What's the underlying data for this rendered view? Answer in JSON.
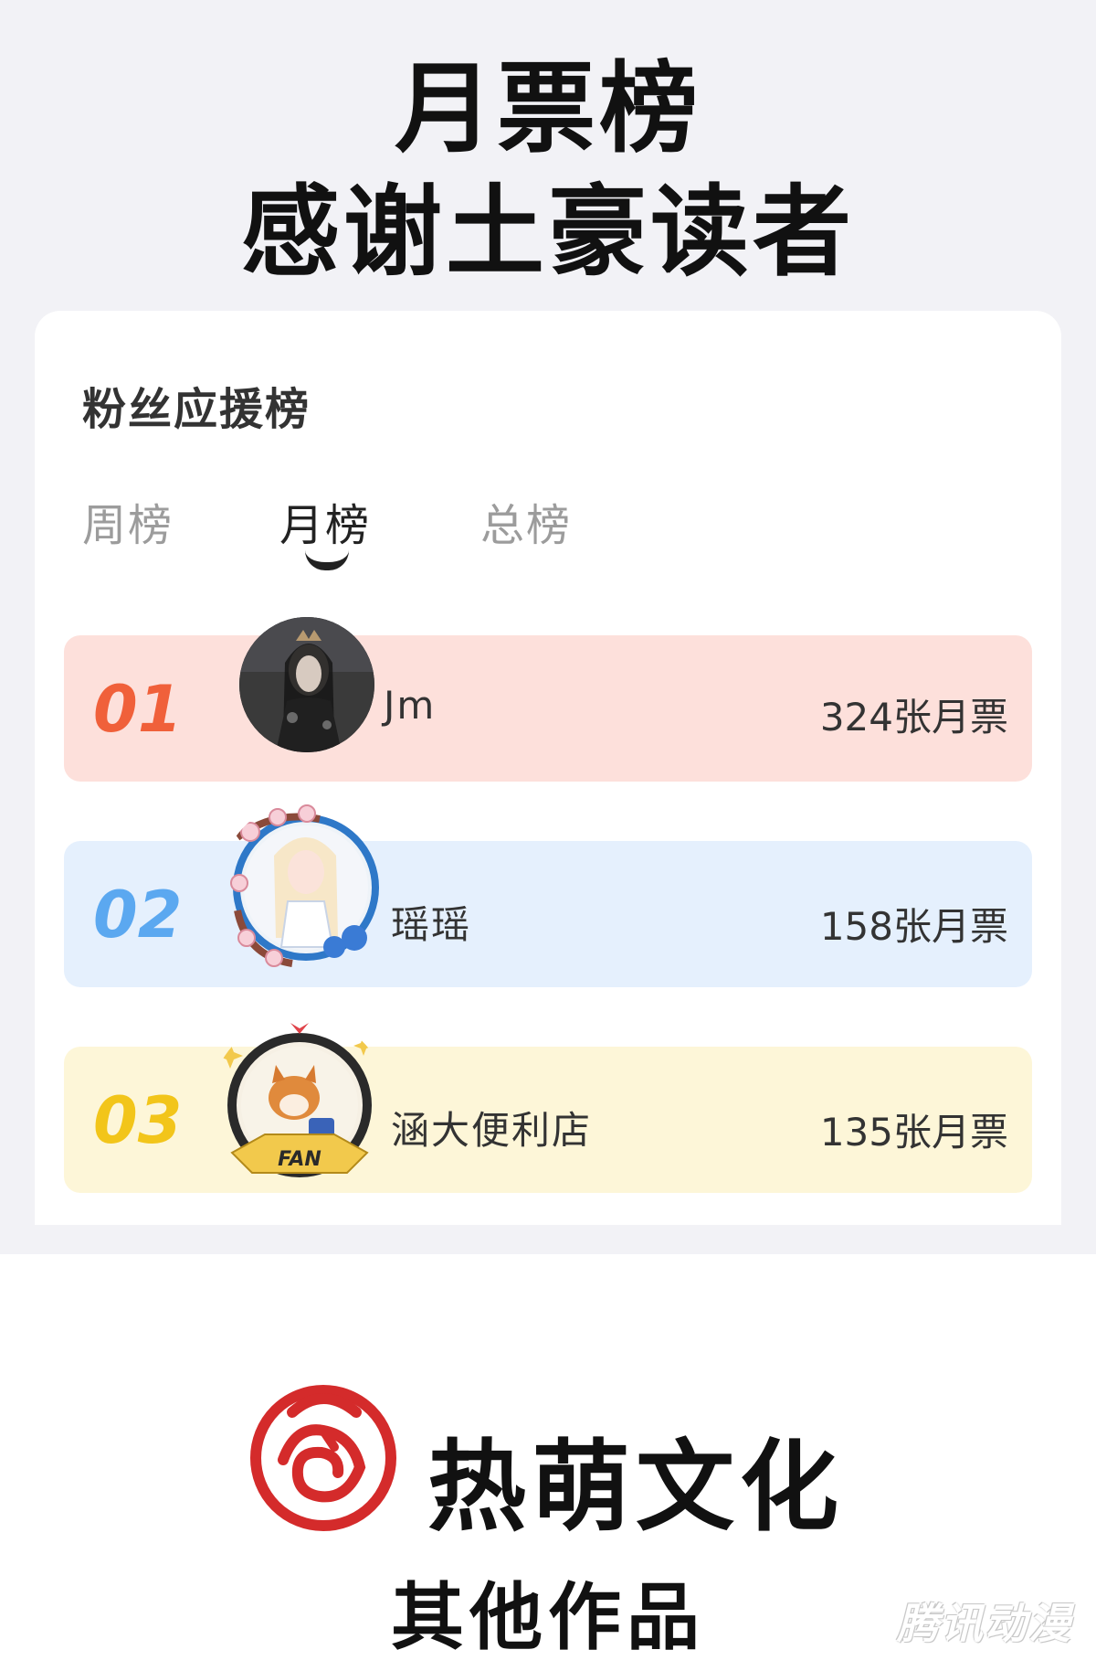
{
  "header": {
    "line1": "月票榜",
    "line2": "感谢土豪读者"
  },
  "card": {
    "title": "粉丝应援榜",
    "tabs": [
      {
        "label": "周榜",
        "active": false
      },
      {
        "label": "月榜",
        "active": true
      },
      {
        "label": "总榜",
        "active": false
      }
    ],
    "rankings": [
      {
        "rank": "01",
        "name": "Jm",
        "tickets": "324张月票",
        "color": "#f0603a",
        "bg": "#fde0db"
      },
      {
        "rank": "02",
        "name": "瑶瑶",
        "tickets": "158张月票",
        "color": "#5ba8f0",
        "bg": "#e5f0fd"
      },
      {
        "rank": "03",
        "name": "涵大便利店",
        "tickets": "135张月票",
        "color": "#f2c51a",
        "bg": "#fdf6d8"
      }
    ]
  },
  "footer": {
    "brand": "热萌文化",
    "logo_icon": "rose-logo-icon",
    "brand_color": "#d42b2b",
    "other_works": "其他作品",
    "watermark": "腾讯动漫"
  }
}
